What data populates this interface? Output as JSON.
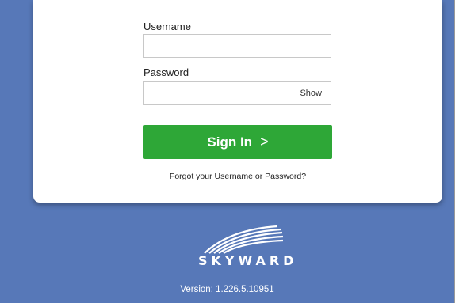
{
  "login": {
    "username_label": "Username",
    "username_value": "",
    "password_label": "Password",
    "password_value": "",
    "show_label": "Show",
    "signin_label": "Sign In",
    "signin_chevron": ">",
    "forgot_label": "Forgot your Username or Password?"
  },
  "brand": {
    "logo_text": "SKYWARD",
    "version": "Version: 1.226.5.10951"
  },
  "colors": {
    "background": "#5778b8",
    "button": "#2ea737",
    "card": "#ffffff"
  }
}
